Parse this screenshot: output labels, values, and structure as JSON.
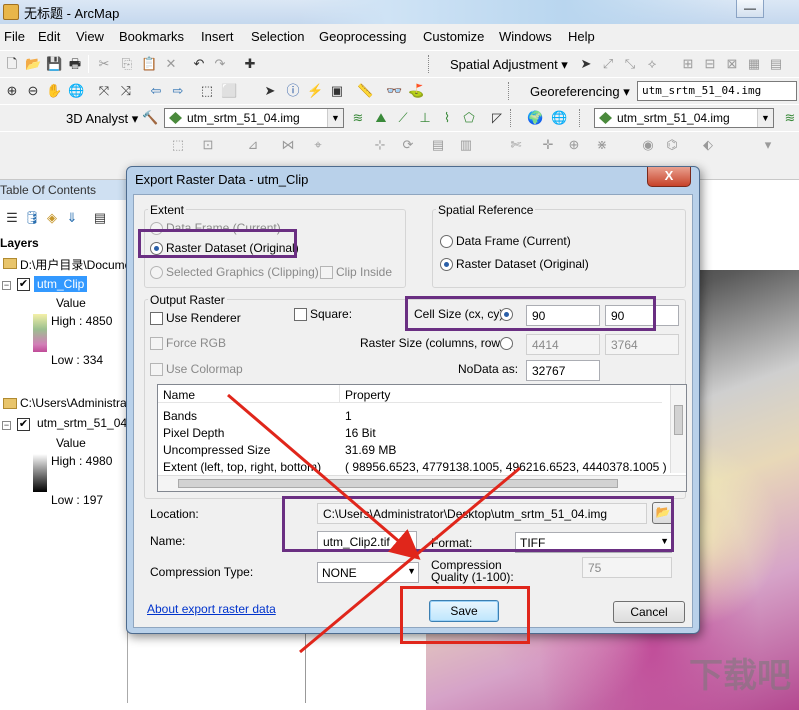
{
  "app": {
    "window_title": "无标题 - ArcMap",
    "minimize": "—"
  },
  "menubar": [
    "File",
    "Edit",
    "View",
    "Bookmarks",
    "Insert",
    "Selection",
    "Geoprocessing",
    "Customize",
    "Windows",
    "Help"
  ],
  "toolbars": {
    "spatial_adjustment": "Spatial Adjustment ▾",
    "georeferencing": "Georeferencing ▾",
    "georef_layer": "utm_srtm_51_04.img",
    "analyst_3d": "3D Analyst ▾",
    "analyst_layer": "utm_srtm_51_04.img",
    "right_layer": "utm_srtm_51_04.img"
  },
  "toc": {
    "header": "Table Of Contents",
    "layers_label": "Layers",
    "group1_path": "D:\\用户目录\\Documents",
    "layer1_name": "utm_Clip",
    "layer1_value_label": "Value",
    "layer1_high": "High : 4850",
    "layer1_low": "Low : 334",
    "group2_path": "C:\\Users\\Administrator",
    "layer2_name": "utm_srtm_51_04",
    "layer2_value_label": "Value",
    "layer2_high": "High : 4980",
    "layer2_low": "Low : 197"
  },
  "dialog": {
    "title": "Export Raster Data - utm_Clip",
    "close": "X",
    "extent": {
      "label": "Extent",
      "opt_data_frame": "Data Frame (Current)",
      "opt_raster_dataset": "Raster Dataset (Original)",
      "opt_selected_graphics": "Selected Graphics (Clipping)",
      "clip_inside": "Clip Inside"
    },
    "spatial_reference": {
      "label": "Spatial Reference",
      "opt_data_frame": "Data Frame (Current)",
      "opt_raster_dataset": "Raster Dataset (Original)"
    },
    "output_raster": {
      "label": "Output Raster",
      "use_renderer": "Use Renderer",
      "square": "Square:",
      "force_rgb": "Force RGB",
      "use_colormap": "Use Colormap",
      "cell_size_label": "Cell Size (cx, cy):",
      "cell_cx": "90",
      "cell_cy": "90",
      "raster_size_label": "Raster Size (columns, rows):",
      "raster_cols": "4414",
      "raster_rows": "3764",
      "nodata_label": "NoData as:",
      "nodata_value": "32767"
    },
    "properties": {
      "col_name": "Name",
      "col_property": "Property",
      "rows": [
        {
          "name": "Bands",
          "value": "1"
        },
        {
          "name": "Pixel Depth",
          "value": "16 Bit"
        },
        {
          "name": "Uncompressed Size",
          "value": "31.69 MB"
        },
        {
          "name": "Extent (left, top, right, bottom)",
          "value": "( 98956.6523, 4779138.1005, 496216.6523, 4440378.1005 )"
        }
      ]
    },
    "location_label": "Location:",
    "location_value": "C:\\Users\\Administrator\\Desktop\\utm_srtm_51_04.img",
    "name_label": "Name:",
    "name_value": "utm_Clip2.tif",
    "format_label": "Format:",
    "format_value": "TIFF",
    "compression_type_label": "Compression Type:",
    "compression_type_value": "NONE",
    "compression_quality_label": "Compression Quality (1-100):",
    "compression_quality_value": "75",
    "about_link": "About export raster data",
    "save": "Save",
    "cancel": "Cancel"
  },
  "map": {
    "watermark": "下载吧"
  },
  "colors": {
    "annotation_purple": "#6a2f82",
    "annotation_red": "#e0261b",
    "dialog_frame": "#b9d1ea",
    "selected_layer": "#3399ff"
  }
}
